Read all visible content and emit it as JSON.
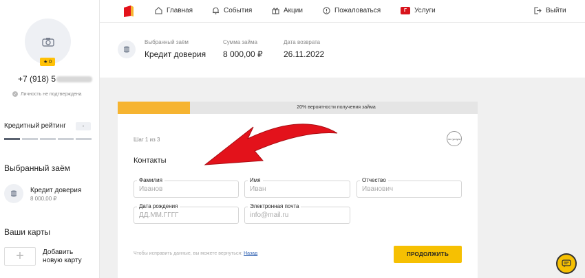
{
  "nav": {
    "items": [
      {
        "label": "Главная",
        "icon": "home-icon"
      },
      {
        "label": "События",
        "icon": "bell-icon"
      },
      {
        "label": "Акции",
        "icon": "gift-icon"
      },
      {
        "label": "Пожаловаться",
        "icon": "alert-icon"
      },
      {
        "label": "Услуги",
        "icon": "gosuslugi-icon"
      }
    ],
    "logout": "Выйти"
  },
  "sidebar": {
    "star_badge": "★ 0",
    "phone": "+7 (918) 5",
    "verify_status": "Личность не подтверждена",
    "rating_label": "Кредитный рейтинг",
    "rating_value": "-",
    "selected_loan_heading": "Выбранный заём",
    "loan_name": "Кредит доверия",
    "loan_amount": "8 000,00 ₽",
    "cards_heading": "Ваши карты",
    "add_card_plus": "+",
    "add_card_label": "Добавить новую карту"
  },
  "summary": {
    "loan_label": "Выбранный заём",
    "loan_value": "Кредит доверия",
    "amount_label": "Сумма займа",
    "amount_value": "8 000,00 ₽",
    "return_label": "Дата возврата",
    "return_value": "26.11.2022"
  },
  "form": {
    "progress_text": "20% вероятности получения займа",
    "progress_percent": 20,
    "gos_logo_text": "гос услуги",
    "step": "Шаг 1 из 3",
    "section_title": "Контакты",
    "fields": {
      "last_name": {
        "label": "Фамилия",
        "placeholder": "Иванов",
        "value": ""
      },
      "first_name": {
        "label": "Имя",
        "placeholder": "Иван",
        "value": ""
      },
      "middle_name": {
        "label": "Отчество",
        "placeholder": "Иванович",
        "value": ""
      },
      "birth_date": {
        "label": "Дата рождения",
        "placeholder": "ДД.ММ.ГГГГ",
        "value": ""
      },
      "email": {
        "label": "Электронная почта",
        "placeholder": "info@mail.ru",
        "value": ""
      }
    },
    "hint_text": "Чтобы исправить данные, вы можете вернуться: ",
    "back_link": "Назад",
    "continue_label": "ПРОДОЛЖИТЬ"
  },
  "colors": {
    "accent_yellow": "#f6c002",
    "progress_fill": "#f6b431",
    "arrow_red": "#e3121b"
  }
}
